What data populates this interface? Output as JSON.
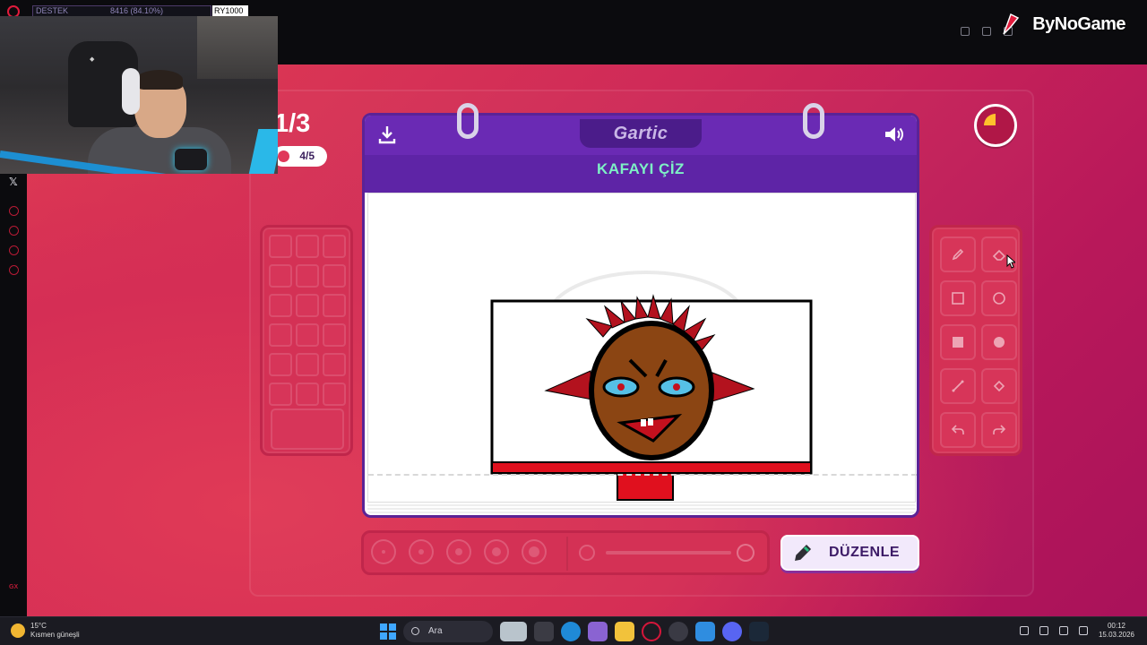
{
  "browser": {
    "overlay_left_label": "DESTEK",
    "overlay_left_value": "8416 (84.10%)",
    "overlay_right_label": "RY1000",
    "brand": "ByNoGame"
  },
  "game": {
    "round": "1/3",
    "players": "4/5",
    "header_logo": "Gartic",
    "task": "KAFAYI ÇİZ",
    "edit_button": "DÜZENLE",
    "timer_elapsed_fraction": 0.25,
    "palette_swatch_count": 18,
    "tool_names": [
      "pencil",
      "eraser",
      "rectangle-outline",
      "circle-outline",
      "rectangle-fill",
      "circle-fill",
      "line",
      "bucket",
      "undo",
      "redo"
    ],
    "brush_sizes": [
      1,
      2,
      3,
      4,
      5
    ],
    "accent_color": "#6a2ab4",
    "title_color": "#7ef0c5"
  },
  "taskbar": {
    "temperature": "15°C",
    "weather": "Kısmen güneşli",
    "search_placeholder": "Ara",
    "time": "00:12",
    "date": "15.03.2026"
  }
}
